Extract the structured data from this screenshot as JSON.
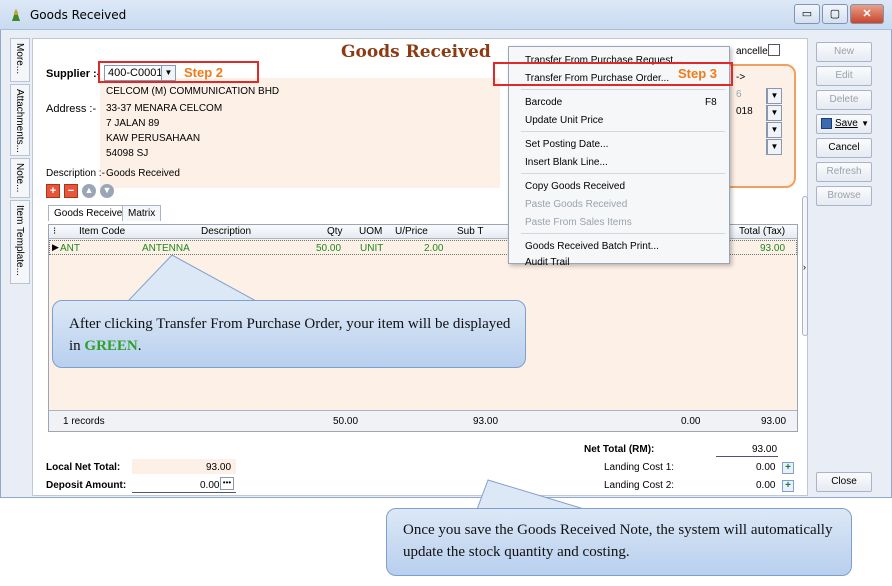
{
  "window": {
    "title": "Goods Received",
    "minimize": "▭",
    "maximize": "▢",
    "close": "✕"
  },
  "side_tabs": [
    "More...",
    "Attachments...",
    "Note...",
    "Item Template..."
  ],
  "form": {
    "heading": "Goods Received",
    "supplier_label": "Supplier :-",
    "supplier_code": "400-C0001",
    "supplier_name": "CELCOM (M) COMMUNICATION BHD",
    "address_label": "Address :-",
    "address_lines": [
      "33-37 MENARA CELCOM",
      "7 JALAN 89",
      "KAW PERUSAHAAN",
      "54098 SJ"
    ],
    "description_label": "Description :-",
    "description_value": "Goods Received",
    "cancelled_label": "ancelled",
    "partial_fields": [
      "->",
      "6",
      "018"
    ]
  },
  "steps": {
    "step2": "Step 2",
    "step3": "Step 3"
  },
  "tabs": [
    "Goods Received",
    "Matrix"
  ],
  "grid": {
    "columns": [
      "Item Code",
      "Description",
      "Qty",
      "UOM",
      "U/Price",
      "Sub T",
      "Total (Tax)"
    ],
    "rows": [
      {
        "item_code": "ANT",
        "description": "ANTENNA",
        "qty": "50.00",
        "uom": "UNIT",
        "uprice": "2.00",
        "total_tax": "93.00"
      }
    ],
    "footer": {
      "records": "1 records",
      "qty": "50.00",
      "subtotal": "93.00",
      "tax": "0.00",
      "total": "93.00"
    }
  },
  "totals": {
    "net_total_label": "Net Total (RM):",
    "net_total": "93.00",
    "landing_cost1_label": "Landing Cost 1:",
    "landing_cost1": "0.00",
    "landing_cost2_label": "Landing Cost 2:",
    "landing_cost2": "0.00",
    "local_net_label": "Local Net Total:",
    "local_net": "93.00",
    "deposit_label": "Deposit Amount:",
    "deposit": "0.00"
  },
  "right_buttons": {
    "new": "New",
    "edit": "Edit",
    "delete": "Delete",
    "save": "Save",
    "cancel": "Cancel",
    "refresh": "Refresh",
    "browse": "Browse",
    "close": "Close"
  },
  "menu": {
    "items": [
      {
        "label": "Transfer From Purchase Request...",
        "disabled": false
      },
      {
        "label": "Transfer From Purchase Order...",
        "disabled": false
      },
      {
        "label": "Barcode",
        "shortcut": "F8",
        "disabled": false
      },
      {
        "label": "Update Unit Price",
        "disabled": false
      },
      {
        "label": "Set Posting Date...",
        "disabled": false
      },
      {
        "label": "Insert Blank Line...",
        "disabled": false
      },
      {
        "label": "Copy Goods Received",
        "disabled": false
      },
      {
        "label": "Paste Goods Received",
        "disabled": true
      },
      {
        "label": "Paste From Sales Items",
        "disabled": true
      },
      {
        "label": "Goods Received Batch Print...",
        "disabled": false
      },
      {
        "label": "Audit Trail",
        "disabled": false
      }
    ]
  },
  "callouts": {
    "green_note_prefix": "After clicking Transfer From Purchase Order, your item will be displayed in ",
    "green_word": "GREEN",
    "green_note_suffix": ".",
    "save_note": "Once you save the Goods Received Note, the system will automatically update the stock quantity and costing."
  },
  "colors": {
    "title_brown": "#8c3a12",
    "step_orange": "#f07a18",
    "highlight_red": "#e02a2a",
    "item_green": "#1c8a1c",
    "form_peach": "#fdf0e6"
  }
}
